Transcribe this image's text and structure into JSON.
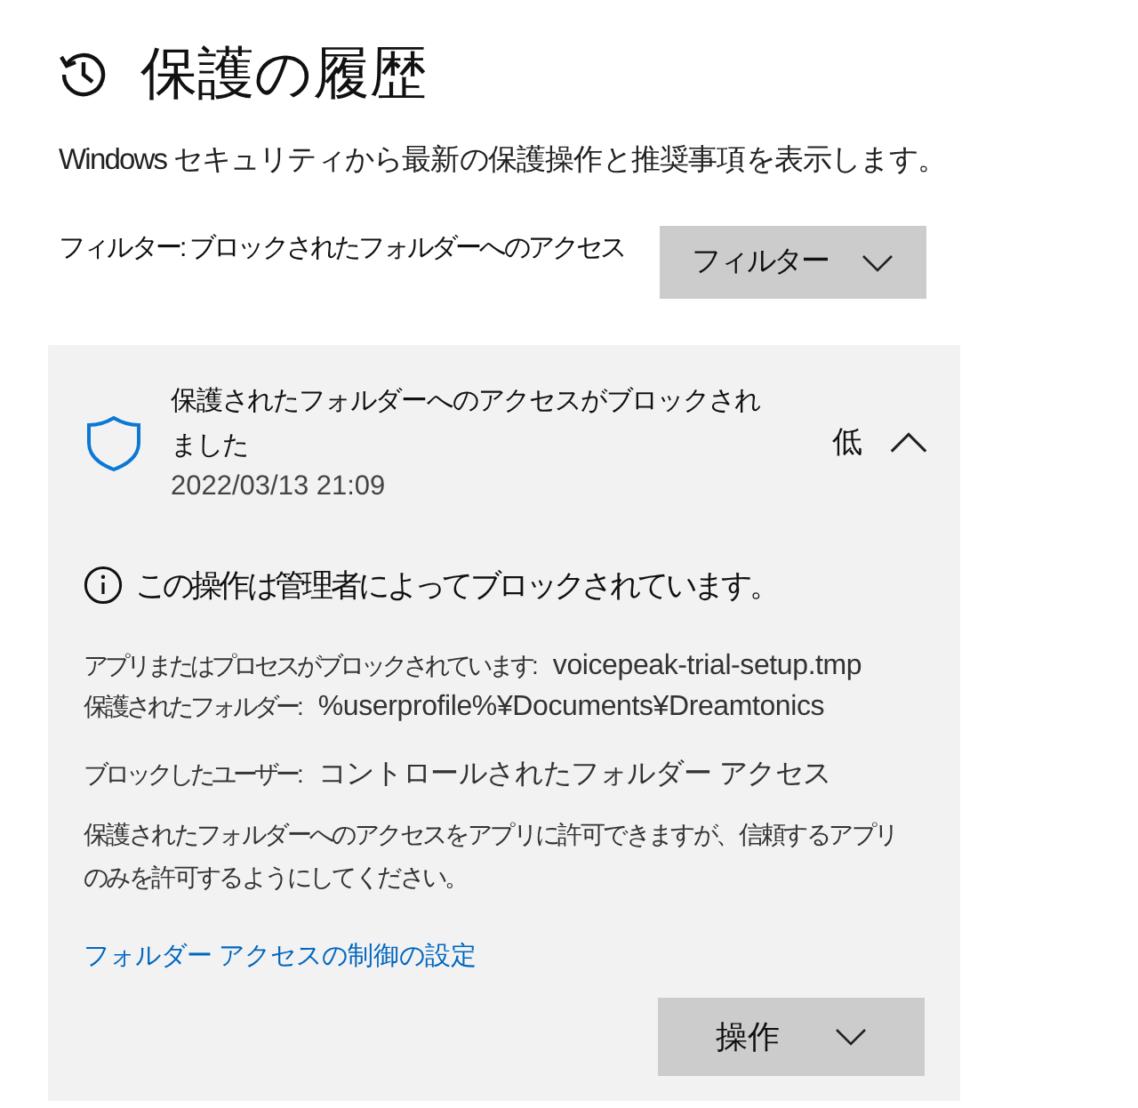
{
  "header": {
    "title": "保護の履歴",
    "description": "Windows セキュリティから最新の保護操作と推奨事項を表示します。"
  },
  "filter": {
    "label": "フィルター: ブロックされたフォルダーへのアクセス",
    "button": "フィルター"
  },
  "events": [
    {
      "title": "保護されたフォルダーへのアクセスがブロックされました",
      "timestamp": "2022/03/13 21:09",
      "severity": "低",
      "expanded": true,
      "summary": "この操作は管理者によってブロックされています。",
      "detail_groups": [
        [
          {
            "label": "アプリまたはプロセスがブロックされています:",
            "value": "voicepeak-trial-setup.tmp"
          },
          {
            "label": "保護されたフォルダー:",
            "value": "%userprofile%¥Documents¥Dreamtonics"
          }
        ],
        [
          {
            "label": "ブロックしたユーザー:",
            "value": "コントロールされたフォルダー アクセス"
          }
        ]
      ],
      "note": "保護されたフォルダーへのアクセスをアプリに許可できますが、信頼するアプリのみを許可するようにしてください。",
      "link": "フォルダー アクセスの制御の設定",
      "action_button": "操作"
    }
  ]
}
